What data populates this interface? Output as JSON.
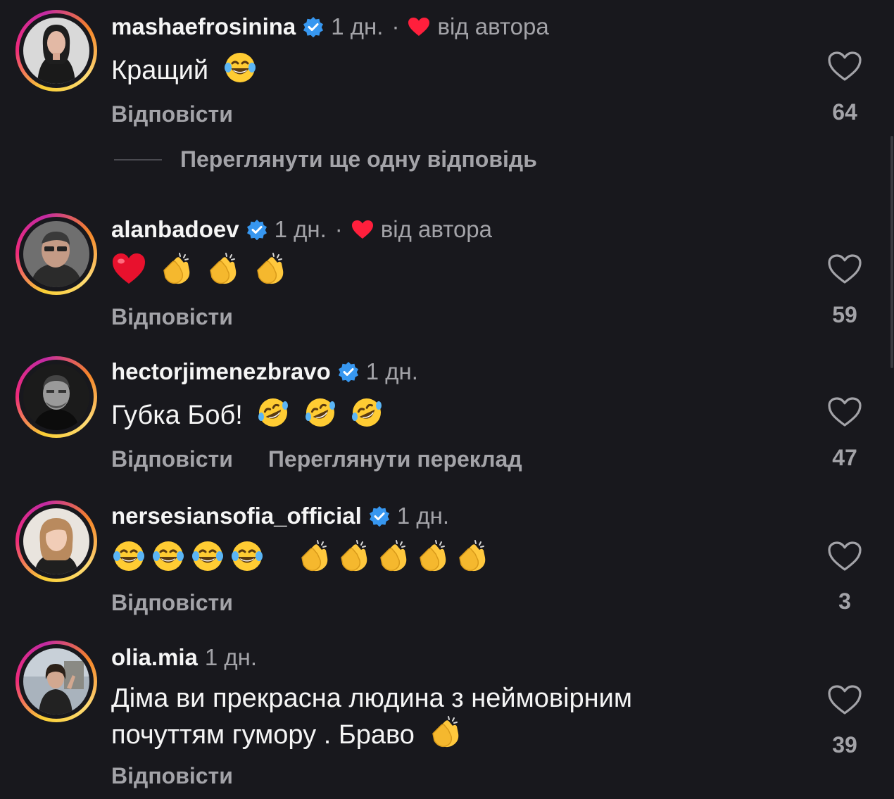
{
  "comments": [
    {
      "username": "mashaefrosinina",
      "verified": true,
      "time": "1 дн.",
      "author_liked": true,
      "author_label": "від автора",
      "text": "Кращий",
      "emoji": [
        "laughing-tears"
      ],
      "reply_label": "Відповісти",
      "likes": "64",
      "view_replies_label": "Переглянути ще одну відповідь"
    },
    {
      "username": "alanbadoev",
      "verified": true,
      "time": "1 дн.",
      "author_liked": true,
      "author_label": "від автора",
      "text": "",
      "emoji": [
        "red-heart",
        "clapping-hands",
        "clapping-hands",
        "clapping-hands"
      ],
      "reply_label": "Відповісти",
      "likes": "59"
    },
    {
      "username": "hectorjimenezbravo",
      "verified": true,
      "time": "1 дн.",
      "author_liked": false,
      "text": "Губка Боб!",
      "emoji": [
        "rolling-laughing",
        "rolling-laughing",
        "rolling-laughing"
      ],
      "reply_label": "Відповісти",
      "translate_label": "Переглянути переклад",
      "likes": "47"
    },
    {
      "username": "nersesiansofia_official",
      "verified": true,
      "time": "1 дн.",
      "author_liked": false,
      "text": "",
      "emoji": [
        "laughing-tears",
        "laughing-tears",
        "laughing-tears",
        "laughing-tears",
        "clapping-hands",
        "clapping-hands",
        "clapping-hands",
        "clapping-hands",
        "clapping-hands"
      ],
      "reply_label": "Відповісти",
      "likes": "3"
    },
    {
      "username": "olia.mia",
      "verified": false,
      "time": "1 дн.",
      "author_liked": false,
      "text_line1": "Діма ви прекрасна людина з неймовірним",
      "text_line2": "почуттям гумору . Браво",
      "emoji": [
        "clapping-hands"
      ],
      "reply_label": "Відповісти",
      "likes": "39"
    }
  ],
  "colors": {
    "background": "#18181d",
    "primary_text": "#f5f5f5",
    "secondary_text": "#a3a3a8",
    "verified_blue": "#3797f0",
    "heart_red": "#ff1f3c"
  }
}
